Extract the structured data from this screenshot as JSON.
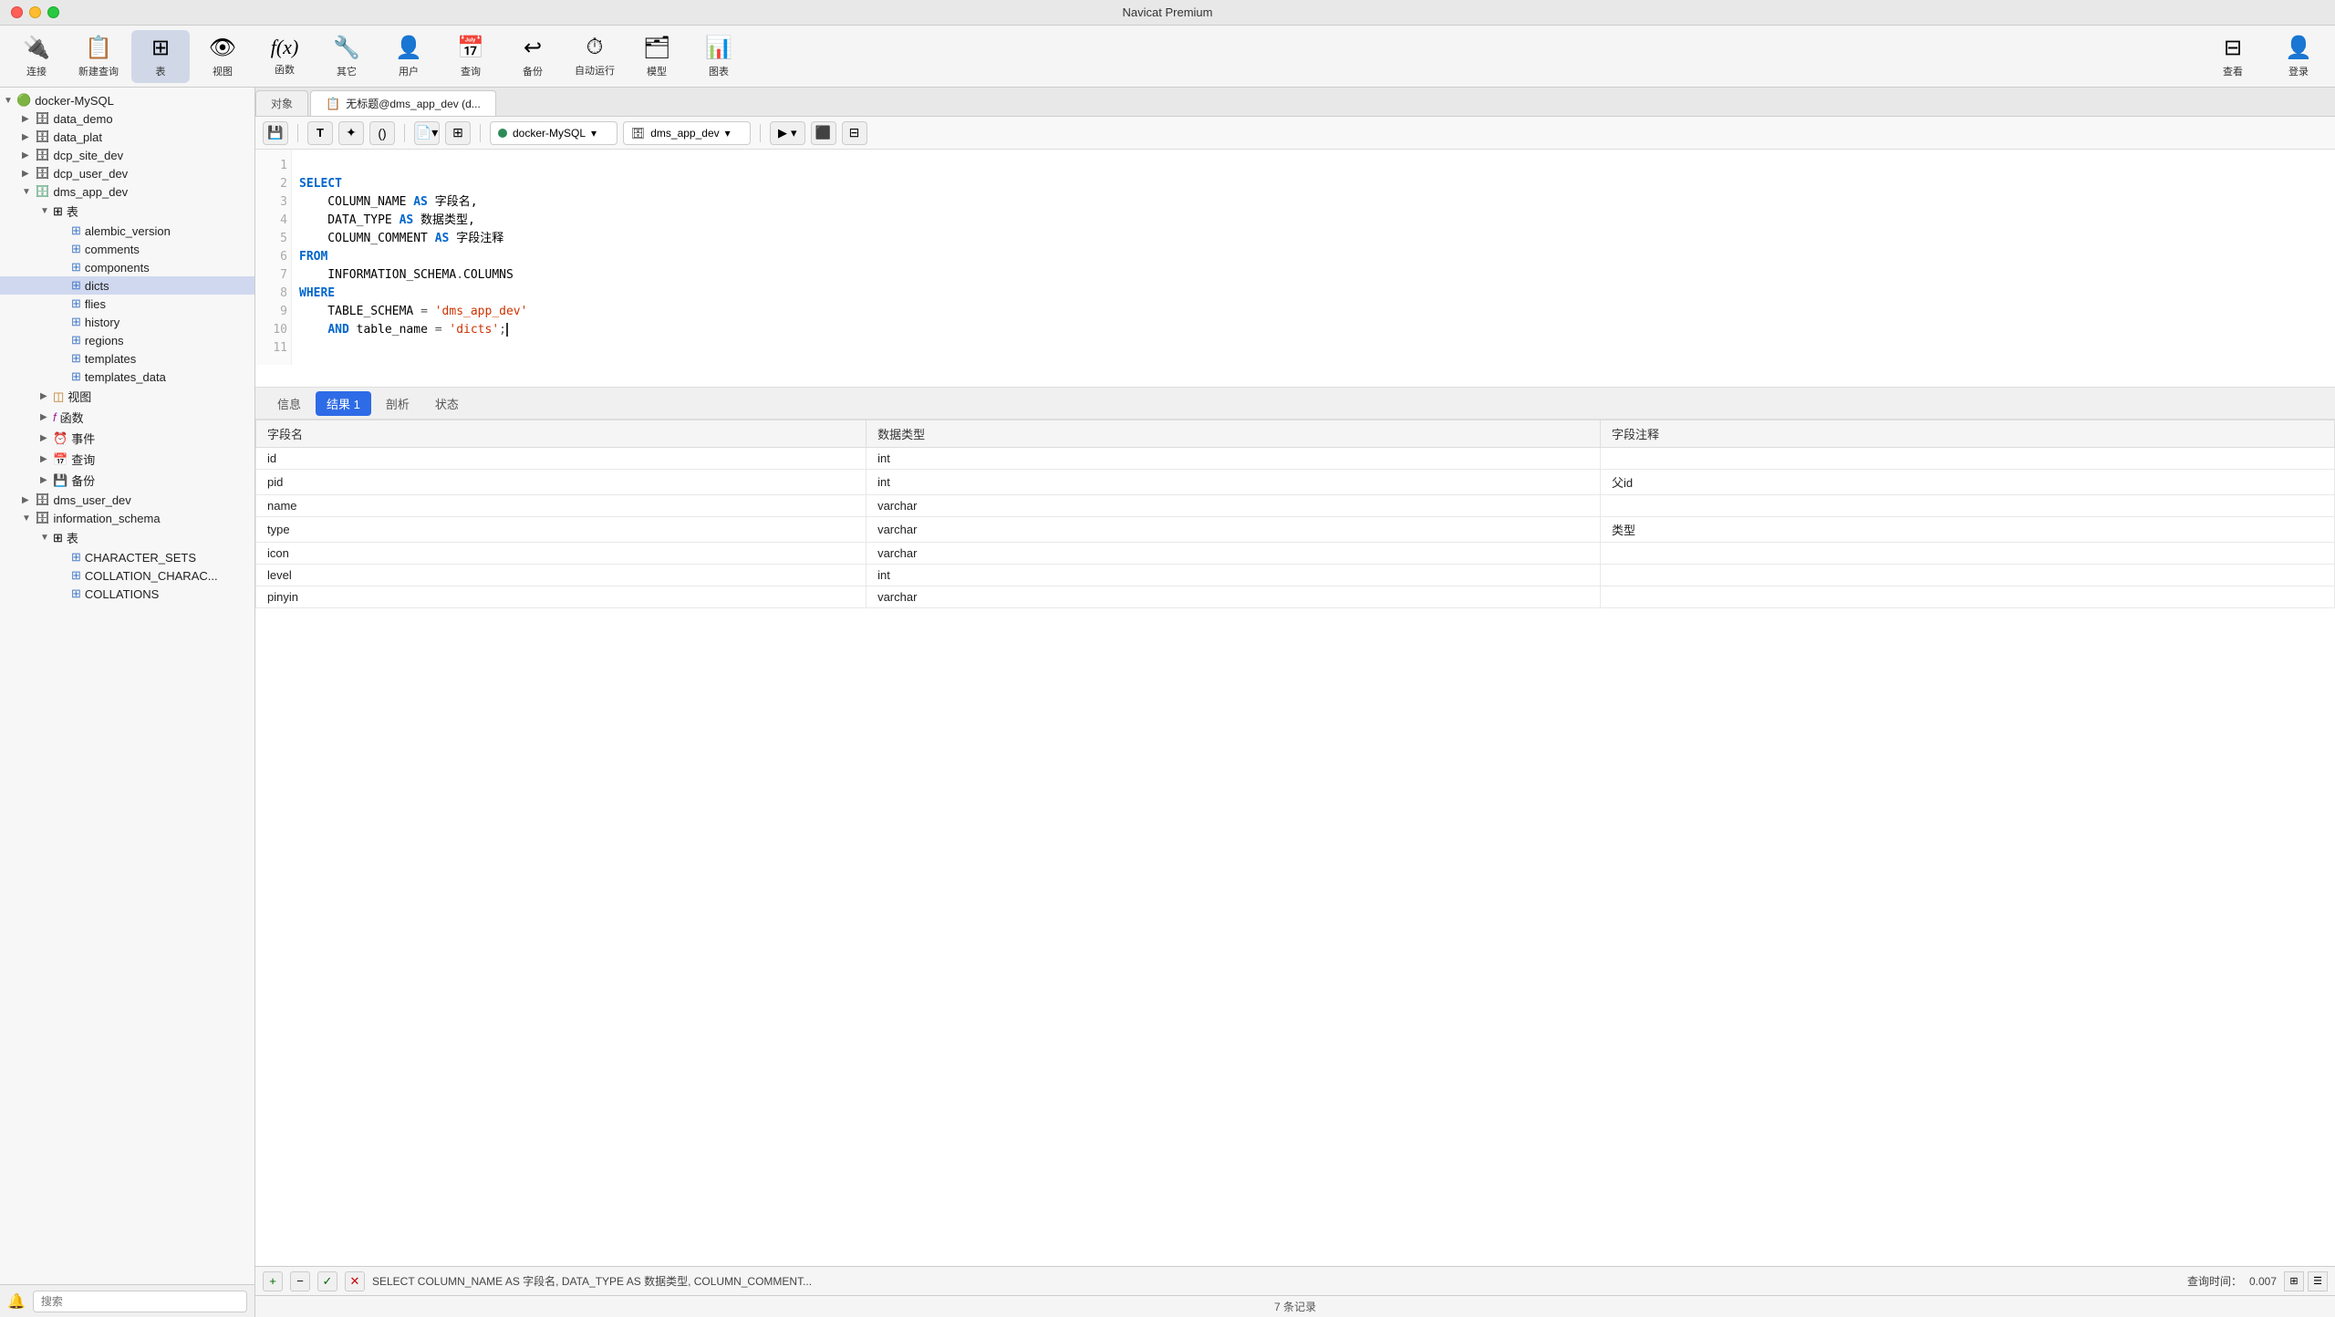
{
  "app": {
    "title": "Navicat Premium"
  },
  "toolbar": {
    "buttons": [
      {
        "id": "connect",
        "label": "连接",
        "icon": "🔌"
      },
      {
        "id": "new-query",
        "label": "新建查询",
        "icon": "📋"
      },
      {
        "id": "table",
        "label": "表",
        "icon": "⊞",
        "active": true
      },
      {
        "id": "view",
        "label": "视图",
        "icon": "👁"
      },
      {
        "id": "function",
        "label": "函数",
        "icon": "ƒ"
      },
      {
        "id": "other",
        "label": "其它",
        "icon": "🔧"
      },
      {
        "id": "user",
        "label": "用户",
        "icon": "👤"
      },
      {
        "id": "query",
        "label": "查询",
        "icon": "📅"
      },
      {
        "id": "backup",
        "label": "备份",
        "icon": "↩"
      },
      {
        "id": "schedule",
        "label": "自动运行",
        "icon": "⏱"
      },
      {
        "id": "model",
        "label": "模型",
        "icon": "🗂"
      },
      {
        "id": "chart",
        "label": "图表",
        "icon": "📊"
      }
    ],
    "right_buttons": [
      {
        "id": "layout",
        "label": "查看",
        "icon": "⊟"
      },
      {
        "id": "login",
        "label": "登录",
        "icon": "👤"
      }
    ]
  },
  "sidebar": {
    "connections": [
      {
        "id": "docker-mysql",
        "name": "docker-MySQL",
        "expanded": true,
        "icon": "🟢",
        "children": [
          {
            "id": "data_demo",
            "name": "data_demo",
            "type": "db",
            "expanded": false
          },
          {
            "id": "data_plat",
            "name": "data_plat",
            "type": "db",
            "expanded": false
          },
          {
            "id": "dcp_site_dev",
            "name": "dcp_site_dev",
            "type": "db",
            "expanded": false
          },
          {
            "id": "dcp_user_dev",
            "name": "dcp_user_dev",
            "type": "db",
            "expanded": false
          },
          {
            "id": "dms_app_dev",
            "name": "dms_app_dev",
            "type": "db",
            "expanded": true,
            "children": [
              {
                "id": "tables_group",
                "name": "表",
                "type": "group",
                "expanded": true,
                "children": [
                  {
                    "id": "alembic_version",
                    "name": "alembic_version",
                    "type": "table"
                  },
                  {
                    "id": "comments",
                    "name": "comments",
                    "type": "table"
                  },
                  {
                    "id": "components",
                    "name": "components",
                    "type": "table"
                  },
                  {
                    "id": "dicts",
                    "name": "dicts",
                    "type": "table",
                    "selected": true
                  },
                  {
                    "id": "flies",
                    "name": "flies",
                    "type": "table"
                  },
                  {
                    "id": "history",
                    "name": "history",
                    "type": "table"
                  },
                  {
                    "id": "regions",
                    "name": "regions",
                    "type": "table"
                  },
                  {
                    "id": "templates",
                    "name": "templates",
                    "type": "table"
                  },
                  {
                    "id": "templates_data",
                    "name": "templates_data",
                    "type": "table"
                  }
                ]
              },
              {
                "id": "views_group",
                "name": "视图",
                "type": "group",
                "expanded": false
              },
              {
                "id": "funcs_group",
                "name": "函数",
                "type": "group",
                "expanded": false
              },
              {
                "id": "events_group",
                "name": "事件",
                "type": "group",
                "expanded": false
              },
              {
                "id": "queries_group",
                "name": "查询",
                "type": "group",
                "expanded": false
              },
              {
                "id": "backups_group",
                "name": "备份",
                "type": "group",
                "expanded": false
              }
            ]
          },
          {
            "id": "dms_user_dev",
            "name": "dms_user_dev",
            "type": "db",
            "expanded": false
          },
          {
            "id": "information_schema",
            "name": "information_schema",
            "type": "db",
            "expanded": true,
            "children": [
              {
                "id": "tables_group2",
                "name": "表",
                "type": "group",
                "expanded": true,
                "children": [
                  {
                    "id": "CHARACTER_SETS",
                    "name": "CHARACTER_SETS",
                    "type": "table"
                  },
                  {
                    "id": "COLLATION_CHARAC",
                    "name": "COLLATION_CHARAC...",
                    "type": "table"
                  },
                  {
                    "id": "COLLATIONS",
                    "name": "COLLATIONS",
                    "type": "table"
                  }
                ]
              }
            ]
          }
        ]
      }
    ],
    "search_placeholder": "搜索"
  },
  "tabs": [
    {
      "id": "object",
      "label": "对象",
      "active": false,
      "icon": ""
    },
    {
      "id": "query1",
      "label": "无标题@dms_app_dev (d...",
      "active": true,
      "icon": "📋"
    }
  ],
  "query_toolbar": {
    "save_icon": "💾",
    "text_icon": "T",
    "magic_icon": "✦",
    "bracket_icon": "()",
    "file_icon": "📄",
    "grid_icon": "⊞",
    "db_connection": "docker-MySQL",
    "db_name": "dms_app_dev",
    "run_icon": "▶",
    "stop_icon": "⬛",
    "explain_icon": "⊟"
  },
  "editor": {
    "lines": [
      {
        "num": 1,
        "content": ""
      },
      {
        "num": 2,
        "content": "SELECT",
        "type": "keyword_line",
        "tokens": [
          {
            "text": "SELECT",
            "class": "kw"
          }
        ]
      },
      {
        "num": 3,
        "content": "    COLUMN_NAME AS 字段名,",
        "tokens": [
          {
            "text": "    COLUMN_NAME ",
            "class": "id"
          },
          {
            "text": "AS",
            "class": "kw"
          },
          {
            "text": " 字段名,",
            "class": "id"
          }
        ]
      },
      {
        "num": 4,
        "content": "    DATA_TYPE AS 数据类型,",
        "tokens": [
          {
            "text": "    DATA_TYPE ",
            "class": "id"
          },
          {
            "text": "AS",
            "class": "kw"
          },
          {
            "text": " 数据类型,",
            "class": "id"
          }
        ]
      },
      {
        "num": 5,
        "content": "    COLUMN_COMMENT AS 字段注释",
        "tokens": [
          {
            "text": "    COLUMN_COMMENT ",
            "class": "id"
          },
          {
            "text": "AS",
            "class": "kw"
          },
          {
            "text": " 字段注释",
            "class": "id"
          }
        ]
      },
      {
        "num": 6,
        "content": "FROM",
        "tokens": [
          {
            "text": "FROM",
            "class": "kw"
          }
        ]
      },
      {
        "num": 7,
        "content": "    INFORMATION_SCHEMA.COLUMNS",
        "tokens": [
          {
            "text": "    INFORMATION_SCHEMA",
            "class": "id"
          },
          {
            "text": ".",
            "class": "op"
          },
          {
            "text": "COLUMNS",
            "class": "id"
          }
        ]
      },
      {
        "num": 8,
        "content": "WHERE",
        "tokens": [
          {
            "text": "WHERE",
            "class": "kw"
          }
        ]
      },
      {
        "num": 9,
        "content": "    TABLE_SCHEMA = 'dms_app_dev'",
        "tokens": [
          {
            "text": "    TABLE_SCHEMA ",
            "class": "id"
          },
          {
            "text": "= ",
            "class": "op"
          },
          {
            "text": "'dms_app_dev'",
            "class": "str"
          }
        ]
      },
      {
        "num": 10,
        "content": "    AND table_name = 'dicts';",
        "tokens": [
          {
            "text": "    ",
            "class": "id"
          },
          {
            "text": "AND",
            "class": "kw"
          },
          {
            "text": " table_name ",
            "class": "id"
          },
          {
            "text": "= ",
            "class": "op"
          },
          {
            "text": "'dicts'",
            "class": "str"
          },
          {
            "text": ";",
            "class": "op"
          }
        ]
      },
      {
        "num": 11,
        "content": ""
      }
    ]
  },
  "result_tabs": [
    {
      "id": "info",
      "label": "信息"
    },
    {
      "id": "result1",
      "label": "结果 1",
      "active": true
    },
    {
      "id": "profile",
      "label": "剖析"
    },
    {
      "id": "status",
      "label": "状态"
    }
  ],
  "result_table": {
    "columns": [
      "字段名",
      "数据类型",
      "字段注释"
    ],
    "rows": [
      {
        "field": "id",
        "type": "int",
        "comment": ""
      },
      {
        "field": "pid",
        "type": "int",
        "comment": "父id"
      },
      {
        "field": "name",
        "type": "varchar",
        "comment": ""
      },
      {
        "field": "type",
        "type": "varchar",
        "comment": "类型"
      },
      {
        "field": "icon",
        "type": "varchar",
        "comment": ""
      },
      {
        "field": "level",
        "type": "int",
        "comment": ""
      },
      {
        "field": "pinyin",
        "type": "varchar",
        "comment": ""
      }
    ]
  },
  "status_bar": {
    "sql_preview": "SELECT  COLUMN_NAME AS 字段名,   DATA_TYPE AS 数据类型, COLUMN_COMMENT...",
    "query_time_label": "查询时间：",
    "query_time_value": "0.007",
    "record_count": "7 条记录"
  },
  "bottom_bar": {
    "add_label": "+",
    "minus_label": "−",
    "check_label": "✓",
    "close_label": "✕"
  }
}
